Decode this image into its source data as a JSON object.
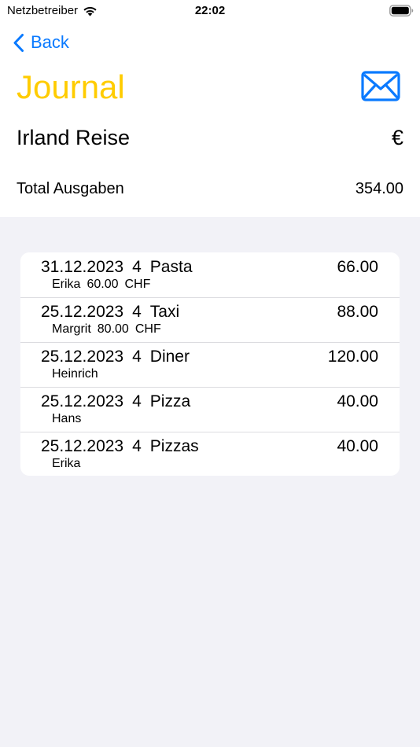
{
  "status_bar": {
    "carrier": "Netzbetreiber",
    "time": "22:02"
  },
  "nav": {
    "back_label": "Back"
  },
  "header": {
    "title": "Journal",
    "title_color": "#ffcc00",
    "action_icon": "envelope-icon",
    "accent_color": "#0a7aff"
  },
  "trip": {
    "name": "Irland Reise",
    "currency": "€"
  },
  "summary": {
    "total_label": "Total Ausgaben",
    "total_value": "354.00"
  },
  "entries": [
    {
      "date": "31.12.2023",
      "count": "4",
      "item": "Pasta",
      "amount": "66.00",
      "payer": "Erika",
      "orig_amount": "60.00",
      "orig_currency": "CHF"
    },
    {
      "date": "25.12.2023",
      "count": "4",
      "item": "Taxi",
      "amount": "88.00",
      "payer": "Margrit",
      "orig_amount": "80.00",
      "orig_currency": "CHF"
    },
    {
      "date": "25.12.2023",
      "count": "4",
      "item": "Diner",
      "amount": "120.00",
      "payer": "Heinrich",
      "orig_amount": "",
      "orig_currency": ""
    },
    {
      "date": "25.12.2023",
      "count": "4",
      "item": "Pizza",
      "amount": "40.00",
      "payer": "Hans",
      "orig_amount": "",
      "orig_currency": ""
    },
    {
      "date": "25.12.2023",
      "count": "4",
      "item": "Pizzas",
      "amount": "40.00",
      "payer": "Erika",
      "orig_amount": "",
      "orig_currency": ""
    }
  ]
}
